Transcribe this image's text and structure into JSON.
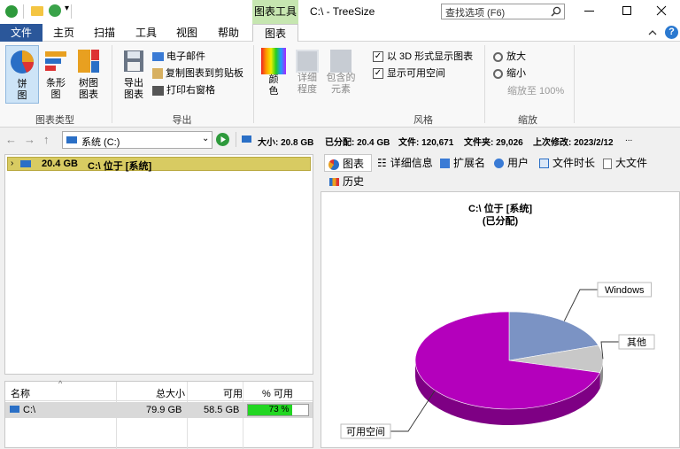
{
  "window": {
    "title": "C:\\ - TreeSize",
    "context_tab": "图表工具",
    "search_placeholder": "查找选项 (F6)"
  },
  "tabs": [
    {
      "label": "文件"
    },
    {
      "label": "主页"
    },
    {
      "label": "扫描"
    },
    {
      "label": "工具"
    },
    {
      "label": "视图"
    },
    {
      "label": "帮助"
    },
    {
      "label": "图表"
    }
  ],
  "ribbon": {
    "chart_type": {
      "label": "图表类型",
      "pie": "饼\n图",
      "bar": "条形\n图",
      "treemap": "树图\n图表"
    },
    "export": {
      "label": "导出",
      "export_chart": "导出\n图表",
      "email": "电子邮件",
      "copy_clipboard": "复制图表到剪贴板",
      "print": "打印右窗格"
    },
    "style": {
      "label": "风格",
      "color": "颜\n色",
      "detail": "详细\n程度",
      "include": "包含的\n元素",
      "show_3d": "以 3D 形式显示图表",
      "show_free": "显示可用空间"
    },
    "zoom": {
      "label": "缩放",
      "zoom_in": "放大",
      "zoom_out": "缩小",
      "zoom_100": "缩放至 100%"
    }
  },
  "addressbar": {
    "path": "系统 (C:)",
    "size": "大小: 20.8 GB",
    "allocated": "已分配: 20.4 GB",
    "files": "文件: 120,671",
    "folders": "文件夹: 29,026",
    "modified": "上次修改: 2023/2/12",
    "more": "..."
  },
  "tree": {
    "row": {
      "size": "20.4 GB",
      "path": "C:\\  位于 [系统]"
    }
  },
  "drives": {
    "headers": [
      "名称",
      "总大小",
      "可用",
      "% 可用"
    ],
    "rows": [
      {
        "name": "C:\\",
        "total": "79.9 GB",
        "free": "58.5 GB",
        "percent_text": "73 %",
        "percent_value": 73
      }
    ]
  },
  "chart_tabs": [
    "图表",
    "详细信息",
    "扩展名",
    "用户",
    "文件时长",
    "大文件",
    "历史"
  ],
  "chart_data": {
    "type": "pie",
    "title": "C:\\  位于 [系统]",
    "subtitle": "(已分配)",
    "slices": [
      {
        "label": "可用空间",
        "value": 71,
        "color": "#b400bc"
      },
      {
        "label": "Windows",
        "value": 20,
        "color": "#7b93c4"
      },
      {
        "label": "其他",
        "value": 9,
        "color": "#c8c8c8"
      }
    ]
  },
  "colors": {
    "accent_blue": "#2b579a",
    "context_green": "#b8e0a0",
    "tree_highlight": "#d6c860",
    "percent_bar": "#22d622"
  }
}
